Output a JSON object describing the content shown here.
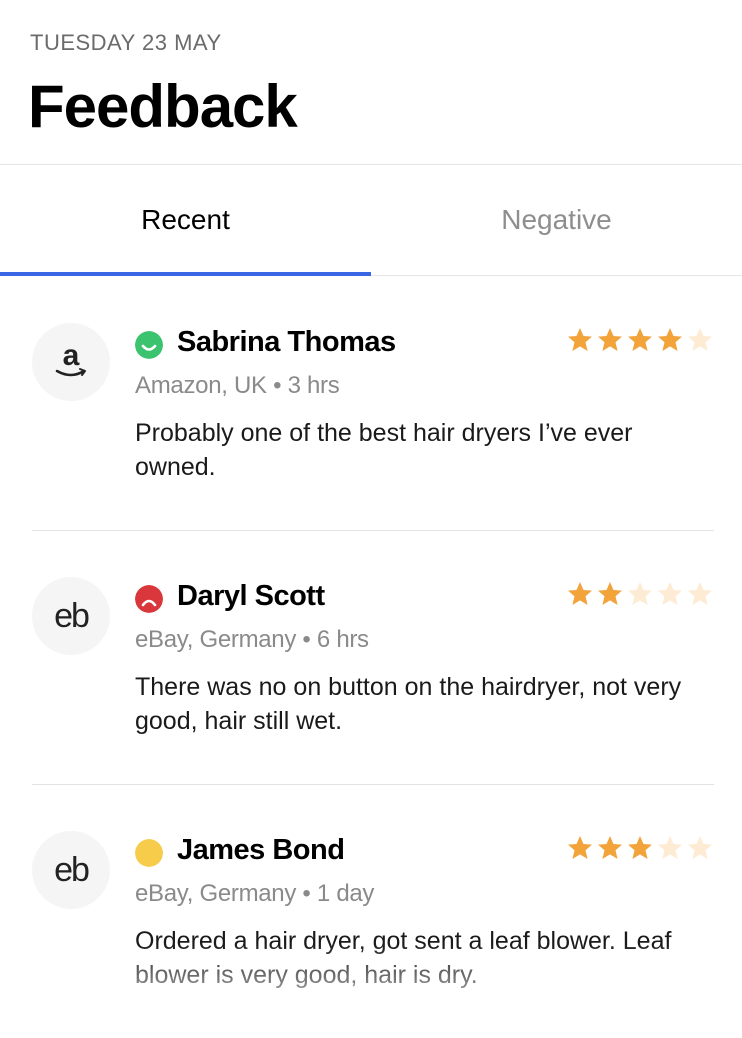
{
  "header": {
    "date": "TUESDAY 23 MAY",
    "title": "Feedback"
  },
  "tabs": [
    {
      "label": "Recent",
      "active": true
    },
    {
      "label": "Negative",
      "active": false
    }
  ],
  "colors": {
    "accent": "#3a66e6",
    "star": "#f2a33a",
    "star_empty": "#fdebd3",
    "positive": "#3cc36f",
    "negative": "#d9373b",
    "neutral": "#f7cc4a"
  },
  "reviews": [
    {
      "name": "Sabrina Thomas",
      "source": "Amazon, UK",
      "time": "3 hrs",
      "text": "Probably one of the best hair dryers I’ve ever owned.",
      "rating": 4,
      "mood": "positive",
      "logo_icon": "amazon-logo-icon"
    },
    {
      "name": "Daryl Scott",
      "source": "eBay, Germany",
      "time": "6 hrs",
      "text": "There was no on button on the hairdryer, not very good, hair still wet.",
      "rating": 2,
      "mood": "negative",
      "logo_text": "eb"
    },
    {
      "name": "James Bond",
      "source": "eBay, Germany",
      "time": "1 day",
      "text": "Ordered a hair dryer, got sent a leaf blower. Leaf blower is very good, hair is dry.",
      "rating": 3,
      "mood": "neutral",
      "logo_text": "eb"
    }
  ]
}
